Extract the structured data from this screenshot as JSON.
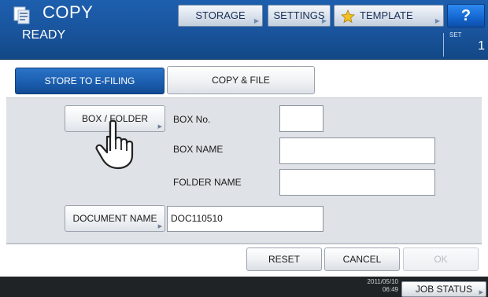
{
  "header": {
    "title": "COPY",
    "status": "READY",
    "storage_label": "STORAGE",
    "settings_label": "SETTINGS",
    "template_label": "TEMPLATE",
    "help_label": "?",
    "set_label": "SET",
    "set_count": "1",
    "icons": [
      "copy-app-icon",
      "star-icon",
      "arrow-icon"
    ]
  },
  "tabs": {
    "store": "STORE TO E-FILING",
    "copy_file": "COPY & FILE",
    "active": "store"
  },
  "form": {
    "box_folder_button": "BOX / FOLDER",
    "box_no_label": "BOX No.",
    "box_no_value": "",
    "box_name_label": "BOX NAME",
    "box_name_value": "",
    "folder_name_label": "FOLDER NAME",
    "folder_name_value": "",
    "document_name_button": "DOCUMENT NAME",
    "document_name_value": "DOC110510"
  },
  "actions": {
    "reset": "RESET",
    "cancel": "CANCEL",
    "ok": "OK",
    "ok_enabled": false
  },
  "footer": {
    "date": "2011/05/10",
    "time": "06:49",
    "job_status": "JOB STATUS"
  },
  "colors": {
    "header_blue": "#1a56a0",
    "active_tab_blue": "#1a5cad",
    "panel_gray": "#dfe2e6",
    "footer_dark": "#202326",
    "help_blue": "#1566d0"
  }
}
